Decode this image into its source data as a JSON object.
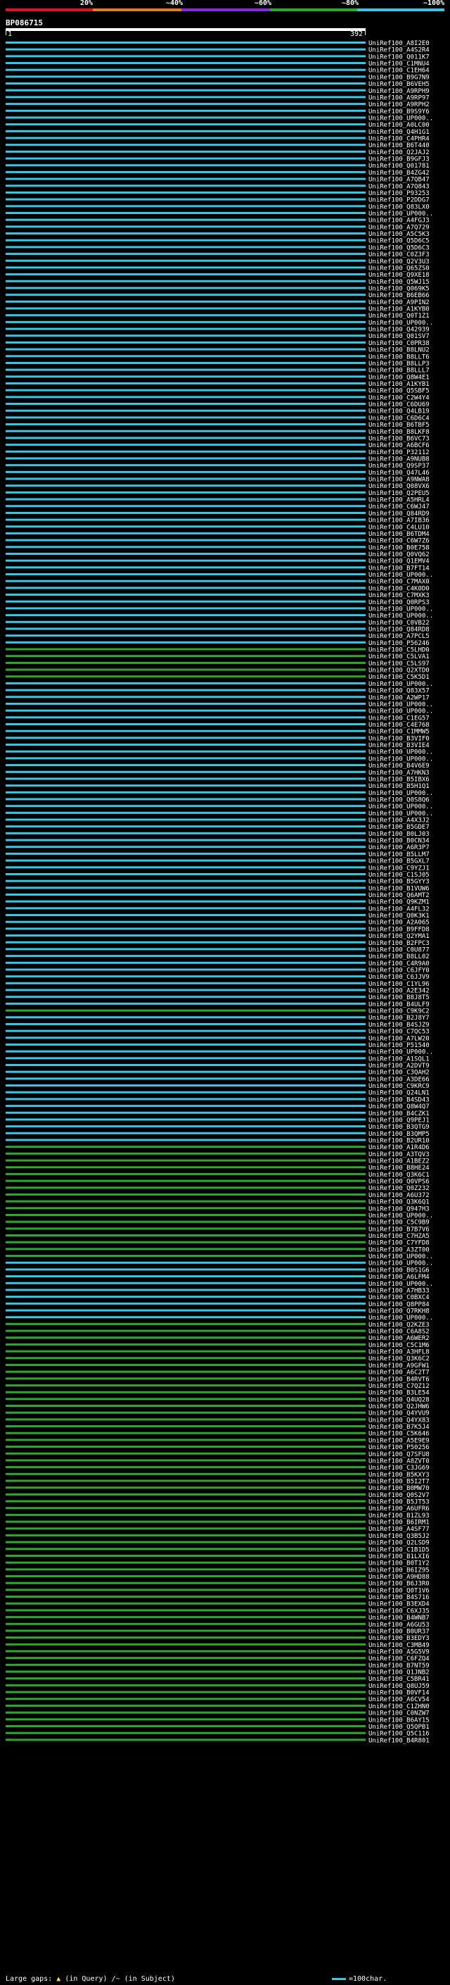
{
  "scale": {
    "labels": [
      "20%",
      "~40%",
      "~60%",
      "~80%",
      "~100%"
    ],
    "colors": [
      "#e0102b",
      "#e07d1a",
      "#8a2be2",
      "#2ea82e",
      "#38c8e6"
    ]
  },
  "query": {
    "id": "BP086715",
    "start": "1",
    "end": "392"
  },
  "hits": [
    {
      "label": "UniRef100_A8I2E0",
      "color": "#38c8e6"
    },
    {
      "label": "UniRef100_A4S2R4",
      "color": "#38c8e6"
    },
    {
      "label": "UniRef100_Q011K7",
      "color": "#38c8e6"
    },
    {
      "label": "UniRef100_C1MNU4",
      "color": "#38c8e6"
    },
    {
      "label": "UniRef100_C1EH64",
      "color": "#38c8e6"
    },
    {
      "label": "UniRef100_B9G7N9",
      "color": "#38c8e6"
    },
    {
      "label": "UniRef100_B6VEH5",
      "color": "#38c8e6"
    },
    {
      "label": "UniRef100_A9RPH9",
      "color": "#38c8e6"
    },
    {
      "label": "UniRef100_A9RP97",
      "color": "#38c8e6"
    },
    {
      "label": "UniRef100_A9RPH2",
      "color": "#38c8e6"
    },
    {
      "label": "UniRef100_B9S9Y6",
      "color": "#38c8e6"
    },
    {
      "label": "UniRef100_UP000..",
      "color": "#38c8e6"
    },
    {
      "label": "UniRef100_A0LC00",
      "color": "#38c8e6"
    },
    {
      "label": "UniRef100_Q4H1G1",
      "color": "#38c8e6"
    },
    {
      "label": "UniRef100_C4PHR4",
      "color": "#38c8e6"
    },
    {
      "label": "UniRef100_B6T440",
      "color": "#38c8e6"
    },
    {
      "label": "UniRef100_Q2JAJ2",
      "color": "#38c8e6"
    },
    {
      "label": "UniRef100_B9GFJ3",
      "color": "#38c8e6"
    },
    {
      "label": "UniRef100_Q01781",
      "color": "#38c8e6"
    },
    {
      "label": "UniRef100_B4ZG42",
      "color": "#38c8e6"
    },
    {
      "label": "UniRef100_A7QB47",
      "color": "#38c8e6"
    },
    {
      "label": "UniRef100_A7Q843",
      "color": "#38c8e6"
    },
    {
      "label": "UniRef100_P93253",
      "color": "#38c8e6"
    },
    {
      "label": "UniRef100_P2DDG7",
      "color": "#38c8e6"
    },
    {
      "label": "UniRef100_Q83LX0",
      "color": "#38c8e6"
    },
    {
      "label": "UniRef100_UP000..",
      "color": "#38c8e6"
    },
    {
      "label": "UniRef100_A4FGJ3",
      "color": "#38c8e6"
    },
    {
      "label": "UniRef100_A7Q729",
      "color": "#38c8e6"
    },
    {
      "label": "UniRef100_A5C5K3",
      "color": "#38c8e6"
    },
    {
      "label": "UniRef100_Q5D6C5",
      "color": "#38c8e6"
    },
    {
      "label": "UniRef100_Q5D6C3",
      "color": "#38c8e6"
    },
    {
      "label": "UniRef100_C0Z3F3",
      "color": "#38c8e6"
    },
    {
      "label": "UniRef100_Q2V3U3",
      "color": "#38c8e6"
    },
    {
      "label": "UniRef100_Q65ZS0",
      "color": "#38c8e6"
    },
    {
      "label": "UniRef100_Q9XE18",
      "color": "#38c8e6"
    },
    {
      "label": "UniRef100_Q5WJ15",
      "color": "#38c8e6"
    },
    {
      "label": "UniRef100_Q069K5",
      "color": "#38c8e6"
    },
    {
      "label": "UniRef100_B6EB66",
      "color": "#38c8e6"
    },
    {
      "label": "UniRef100_A9PIN2",
      "color": "#38c8e6"
    },
    {
      "label": "UniRef100_A1KYB0",
      "color": "#38c8e6"
    },
    {
      "label": "UniRef100_Q0T1Z1",
      "color": "#38c8e6"
    },
    {
      "label": "UniRef100_UP000..",
      "color": "#38c8e6"
    },
    {
      "label": "UniRef100_Q42939",
      "color": "#38c8e6"
    },
    {
      "label": "UniRef100_Q01SV7",
      "color": "#38c8e6"
    },
    {
      "label": "UniRef100_C0PR38",
      "color": "#38c8e6"
    },
    {
      "label": "UniRef100_B8LNU2",
      "color": "#38c8e6"
    },
    {
      "label": "UniRef100_B8LLT6",
      "color": "#38c8e6"
    },
    {
      "label": "UniRef100_B8LLP3",
      "color": "#38c8e6"
    },
    {
      "label": "UniRef100_B8LLL7",
      "color": "#38c8e6"
    },
    {
      "label": "UniRef100_Q8W4E1",
      "color": "#38c8e6"
    },
    {
      "label": "UniRef100_A1KYB1",
      "color": "#38c8e6"
    },
    {
      "label": "UniRef100_Q5SBF5",
      "color": "#38c8e6"
    },
    {
      "label": "UniRef100_C2W4Y4",
      "color": "#38c8e6"
    },
    {
      "label": "UniRef100_C6DU69",
      "color": "#38c8e6"
    },
    {
      "label": "UniRef100_Q4LB19",
      "color": "#38c8e6"
    },
    {
      "label": "UniRef100_C6D6C4",
      "color": "#38c8e6"
    },
    {
      "label": "UniRef100_B6TBF5",
      "color": "#38c8e6"
    },
    {
      "label": "UniRef100_B8LKF8",
      "color": "#38c8e6"
    },
    {
      "label": "UniRef100_B6VC73",
      "color": "#38c8e6"
    },
    {
      "label": "UniRef100_A6BCF6",
      "color": "#38c8e6"
    },
    {
      "label": "UniRef100_P32112",
      "color": "#38c8e6"
    },
    {
      "label": "UniRef100_A9NUB8",
      "color": "#38c8e6"
    },
    {
      "label": "UniRef100_Q9SP37",
      "color": "#38c8e6"
    },
    {
      "label": "UniRef100_Q47L46",
      "color": "#38c8e6"
    },
    {
      "label": "UniRef100_A9NWA8",
      "color": "#38c8e6"
    },
    {
      "label": "UniRef100_Q08VX6",
      "color": "#38c8e6"
    },
    {
      "label": "UniRef100_Q2PEU5",
      "color": "#38c8e6"
    },
    {
      "label": "UniRef100_A5HRL4",
      "color": "#38c8e6"
    },
    {
      "label": "UniRef100_C6WJ47",
      "color": "#38c8e6"
    },
    {
      "label": "UniRef100_Q84RD9",
      "color": "#38c8e6"
    },
    {
      "label": "UniRef100_A7IB36",
      "color": "#38c8e6"
    },
    {
      "label": "UniRef100_C4LU10",
      "color": "#38c8e6"
    },
    {
      "label": "UniRef100_B6TDM4",
      "color": "#38c8e6"
    },
    {
      "label": "UniRef100_C6W7Z6",
      "color": "#38c8e6"
    },
    {
      "label": "UniRef100_B0E758",
      "color": "#38c8e6"
    },
    {
      "label": "UniRef100_Q0VQ62",
      "color": "#38c8e6"
    },
    {
      "label": "UniRef100_Q1EMV4",
      "color": "#38c8e6"
    },
    {
      "label": "UniRef100_B7FT14",
      "color": "#38c8e6"
    },
    {
      "label": "UniRef100_UP000..",
      "color": "#38c8e6"
    },
    {
      "label": "UniRef100_C7MAX0",
      "color": "#38c8e6"
    },
    {
      "label": "UniRef100_C4K0D0",
      "color": "#38c8e6"
    },
    {
      "label": "UniRef100_C7MXK3",
      "color": "#38c8e6"
    },
    {
      "label": "UniRef100_Q0RPS3",
      "color": "#38c8e6"
    },
    {
      "label": "UniRef100_UP000..",
      "color": "#38c8e6"
    },
    {
      "label": "UniRef100_UP000..",
      "color": "#38c8e6"
    },
    {
      "label": "UniRef100_C0VB22",
      "color": "#38c8e6"
    },
    {
      "label": "UniRef100_Q84RD8",
      "color": "#38c8e6"
    },
    {
      "label": "UniRef100_A7PCL5",
      "color": "#38c8e6"
    },
    {
      "label": "UniRef100_P56246",
      "color": "#38c8e6"
    },
    {
      "label": "UniRef100_C5LHD0",
      "color": "#2ea82e"
    },
    {
      "label": "UniRef100_C5LVA1",
      "color": "#2ea82e"
    },
    {
      "label": "UniRef100_C5LS97",
      "color": "#2ea82e"
    },
    {
      "label": "UniRef100_Q2XTD0",
      "color": "#2ea82e"
    },
    {
      "label": "UniRef100_C5K5D1",
      "color": "#2ea82e"
    },
    {
      "label": "UniRef100_UP000..",
      "color": "#38c8e6"
    },
    {
      "label": "UniRef100_Q83X57",
      "color": "#38c8e6"
    },
    {
      "label": "UniRef100_A2WP17",
      "color": "#38c8e6"
    },
    {
      "label": "UniRef100_UP000..",
      "color": "#38c8e6"
    },
    {
      "label": "UniRef100_UP000..",
      "color": "#38c8e6"
    },
    {
      "label": "UniRef100_C1EG57",
      "color": "#38c8e6"
    },
    {
      "label": "UniRef100_C4E768",
      "color": "#38c8e6"
    },
    {
      "label": "UniRef100_C1MMW5",
      "color": "#38c8e6"
    },
    {
      "label": "UniRef100_B3VIF0",
      "color": "#38c8e6"
    },
    {
      "label": "UniRef100_B3VIE4",
      "color": "#38c8e6"
    },
    {
      "label": "UniRef100_UP000..",
      "color": "#38c8e6"
    },
    {
      "label": "UniRef100_UP000..",
      "color": "#38c8e6"
    },
    {
      "label": "UniRef100_B4V6E9",
      "color": "#38c8e6"
    },
    {
      "label": "UniRef100_A7HKN3",
      "color": "#38c8e6"
    },
    {
      "label": "UniRef100_B5IBX6",
      "color": "#38c8e6"
    },
    {
      "label": "UniRef100_B5H1Q1",
      "color": "#38c8e6"
    },
    {
      "label": "UniRef100_UP000..",
      "color": "#38c8e6"
    },
    {
      "label": "UniRef100_Q0S8Q6",
      "color": "#38c8e6"
    },
    {
      "label": "UniRef100_UP000..",
      "color": "#38c8e6"
    },
    {
      "label": "UniRef100_UP000..",
      "color": "#38c8e6"
    },
    {
      "label": "UniRef100_A4X3J2",
      "color": "#38c8e6"
    },
    {
      "label": "UniRef100_B5GDE7",
      "color": "#38c8e6"
    },
    {
      "label": "UniRef100_B0LJ03",
      "color": "#38c8e6"
    },
    {
      "label": "UniRef100_B0CN34",
      "color": "#38c8e6"
    },
    {
      "label": "UniRef100_A6R3P7",
      "color": "#38c8e6"
    },
    {
      "label": "UniRef100_B5LLM7",
      "color": "#38c8e6"
    },
    {
      "label": "UniRef100_B5GXL7",
      "color": "#38c8e6"
    },
    {
      "label": "UniRef100_C9YZJ1",
      "color": "#38c8e6"
    },
    {
      "label": "UniRef100_C1SJ05",
      "color": "#38c8e6"
    },
    {
      "label": "UniRef100_B5GYY3",
      "color": "#38c8e6"
    },
    {
      "label": "UniRef100_B1VUW6",
      "color": "#38c8e6"
    },
    {
      "label": "UniRef100_Q6AMT2",
      "color": "#38c8e6"
    },
    {
      "label": "UniRef100_Q9KZM1",
      "color": "#38c8e6"
    },
    {
      "label": "UniRef100_A4FL32",
      "color": "#38c8e6"
    },
    {
      "label": "UniRef100_Q0K3K1",
      "color": "#38c8e6"
    },
    {
      "label": "UniRef100_A2A065",
      "color": "#38c8e6"
    },
    {
      "label": "UniRef100_B9FFD8",
      "color": "#38c8e6"
    },
    {
      "label": "UniRef100_Q2YMA1",
      "color": "#38c8e6"
    },
    {
      "label": "UniRef100_B2FPC3",
      "color": "#38c8e6"
    },
    {
      "label": "UniRef100_C0U877",
      "color": "#38c8e6"
    },
    {
      "label": "UniRef100_B8LL02",
      "color": "#38c8e6"
    },
    {
      "label": "UniRef100_C4R9A0",
      "color": "#38c8e6"
    },
    {
      "label": "UniRef100_C6JFY0",
      "color": "#38c8e6"
    },
    {
      "label": "UniRef100_C6JJV9",
      "color": "#38c8e6"
    },
    {
      "label": "UniRef100_C1YL96",
      "color": "#38c8e6"
    },
    {
      "label": "UniRef100_A2E342",
      "color": "#38c8e6"
    },
    {
      "label": "UniRef100_B8J8T5",
      "color": "#38c8e6"
    },
    {
      "label": "UniRef100_B4ULF9",
      "color": "#38c8e6"
    },
    {
      "label": "UniRef100_C9K9C2",
      "color": "#2ea82e"
    },
    {
      "label": "UniRef100_B2J8Y7",
      "color": "#38c8e6"
    },
    {
      "label": "UniRef100_B4SJZ9",
      "color": "#38c8e6"
    },
    {
      "label": "UniRef100_C7QC53",
      "color": "#38c8e6"
    },
    {
      "label": "UniRef100_A7LW20",
      "color": "#38c8e6"
    },
    {
      "label": "UniRef100_P51540",
      "color": "#38c8e6"
    },
    {
      "label": "UniRef100_UP000..",
      "color": "#38c8e6"
    },
    {
      "label": "UniRef100_A1SQL1",
      "color": "#38c8e6"
    },
    {
      "label": "UniRef100_A2DVT9",
      "color": "#38c8e6"
    },
    {
      "label": "UniRef100_C3QAH2",
      "color": "#38c8e6"
    },
    {
      "label": "UniRef100_A3DE66",
      "color": "#38c8e6"
    },
    {
      "label": "UniRef100_C9KRC9",
      "color": "#38c8e6"
    },
    {
      "label": "UniRef100_Q24LN1",
      "color": "#38c8e6"
    },
    {
      "label": "UniRef100_B4SD43",
      "color": "#38c8e6"
    },
    {
      "label": "UniRef100_Q8W4Q7",
      "color": "#38c8e6"
    },
    {
      "label": "UniRef100_B4CZK1",
      "color": "#38c8e6"
    },
    {
      "label": "UniRef100_Q9PEJ1",
      "color": "#38c8e6"
    },
    {
      "label": "UniRef100_B3QTG9",
      "color": "#38c8e6"
    },
    {
      "label": "UniRef100_B3QMP5",
      "color": "#38c8e6"
    },
    {
      "label": "UniRef100_B2UR10",
      "color": "#38c8e6"
    },
    {
      "label": "UniRef100_A1R4D6",
      "color": "#2ea82e"
    },
    {
      "label": "UniRef100_A3TQV3",
      "color": "#2ea82e"
    },
    {
      "label": "UniRef100_A1BEZ2",
      "color": "#2ea82e"
    },
    {
      "label": "UniRef100_B8HE24",
      "color": "#2ea82e"
    },
    {
      "label": "UniRef100_Q3K6C1",
      "color": "#2ea82e"
    },
    {
      "label": "UniRef100_Q0VPS6",
      "color": "#2ea82e"
    },
    {
      "label": "UniRef100_Q0Z232",
      "color": "#2ea82e"
    },
    {
      "label": "UniRef100_A6U372",
      "color": "#2ea82e"
    },
    {
      "label": "UniRef100_Q3K6Q1",
      "color": "#2ea82e"
    },
    {
      "label": "UniRef100_Q947H3",
      "color": "#2ea82e"
    },
    {
      "label": "UniRef100_UP000..",
      "color": "#2ea82e"
    },
    {
      "label": "UniRef100_C5C9B9",
      "color": "#2ea82e"
    },
    {
      "label": "UniRef100_B7B7V6",
      "color": "#2ea82e"
    },
    {
      "label": "UniRef100_C7HZA5",
      "color": "#2ea82e"
    },
    {
      "label": "UniRef100_C7YFD8",
      "color": "#2ea82e"
    },
    {
      "label": "UniRef100_A3ZT00",
      "color": "#2ea82e"
    },
    {
      "label": "UniRef100_UP000..",
      "color": "#2ea82e"
    },
    {
      "label": "UniRef100_UP000..",
      "color": "#38c8e6"
    },
    {
      "label": "UniRef100_B0S1G6",
      "color": "#38c8e6"
    },
    {
      "label": "UniRef100_A6LFM4",
      "color": "#38c8e6"
    },
    {
      "label": "UniRef100_UP000..",
      "color": "#38c8e6"
    },
    {
      "label": "UniRef100_A7HB33",
      "color": "#38c8e6"
    },
    {
      "label": "UniRef100_C0BXC4",
      "color": "#38c8e6"
    },
    {
      "label": "UniRef100_Q8PP84",
      "color": "#38c8e6"
    },
    {
      "label": "UniRef100_Q7RKH8",
      "color": "#38c8e6"
    },
    {
      "label": "UniRef100_UP000..",
      "color": "#38c8e6"
    },
    {
      "label": "UniRef100_Q2KZE3",
      "color": "#2ea82e"
    },
    {
      "label": "UniRef100_C6A8S2",
      "color": "#2ea82e"
    },
    {
      "label": "UniRef100_A6WER2",
      "color": "#2ea82e"
    },
    {
      "label": "UniRef100_C5C1M6",
      "color": "#2ea82e"
    },
    {
      "label": "UniRef100_A3HFL8",
      "color": "#2ea82e"
    },
    {
      "label": "UniRef100_Q3K6C2",
      "color": "#2ea82e"
    },
    {
      "label": "UniRef100_A9GFW1",
      "color": "#2ea82e"
    },
    {
      "label": "UniRef100_A6C2T7",
      "color": "#2ea82e"
    },
    {
      "label": "UniRef100_B4RVT6",
      "color": "#2ea82e"
    },
    {
      "label": "UniRef100_C7QZ12",
      "color": "#2ea82e"
    },
    {
      "label": "UniRef100_B3LE54",
      "color": "#2ea82e"
    },
    {
      "label": "UniRef100_Q4UQ28",
      "color": "#2ea82e"
    },
    {
      "label": "UniRef100_Q2JHW6",
      "color": "#2ea82e"
    },
    {
      "label": "UniRef100_Q4YVU9",
      "color": "#2ea82e"
    },
    {
      "label": "UniRef100_Q4YX83",
      "color": "#2ea82e"
    },
    {
      "label": "UniRef100_B7K5J4",
      "color": "#2ea82e"
    },
    {
      "label": "UniRef100_C5K646",
      "color": "#2ea82e"
    },
    {
      "label": "UniRef100_A5E9E9",
      "color": "#2ea82e"
    },
    {
      "label": "UniRef100_P50256",
      "color": "#2ea82e"
    },
    {
      "label": "UniRef100_Q7SFU8",
      "color": "#2ea82e"
    },
    {
      "label": "UniRef100_A8ZVT0",
      "color": "#2ea82e"
    },
    {
      "label": "UniRef100_C3JG69",
      "color": "#2ea82e"
    },
    {
      "label": "UniRef100_B5KXY3",
      "color": "#2ea82e"
    },
    {
      "label": "UniRef100_B5I2T7",
      "color": "#2ea82e"
    },
    {
      "label": "UniRef100_B0MW70",
      "color": "#2ea82e"
    },
    {
      "label": "UniRef100_Q0S2V7",
      "color": "#2ea82e"
    },
    {
      "label": "UniRef100_B5JT53",
      "color": "#2ea82e"
    },
    {
      "label": "UniRef100_A6UFR6",
      "color": "#2ea82e"
    },
    {
      "label": "UniRef100_B1ZL93",
      "color": "#2ea82e"
    },
    {
      "label": "UniRef100_B6IRM1",
      "color": "#2ea82e"
    },
    {
      "label": "UniRef100_A4SF77",
      "color": "#2ea82e"
    },
    {
      "label": "UniRef100_Q3B5J2",
      "color": "#2ea82e"
    },
    {
      "label": "UniRef100_Q2LSD9",
      "color": "#2ea82e"
    },
    {
      "label": "UniRef100_C1B1D5",
      "color": "#2ea82e"
    },
    {
      "label": "UniRef100_B1LXI6",
      "color": "#2ea82e"
    },
    {
      "label": "UniRef100_B0T1Y2",
      "color": "#2ea82e"
    },
    {
      "label": "UniRef100_B6IZ95",
      "color": "#2ea82e"
    },
    {
      "label": "UniRef100_A9HD88",
      "color": "#2ea82e"
    },
    {
      "label": "UniRef100_B6J3R0",
      "color": "#2ea82e"
    },
    {
      "label": "UniRef100_Q0T1V6",
      "color": "#2ea82e"
    },
    {
      "label": "UniRef100_B4S716",
      "color": "#2ea82e"
    },
    {
      "label": "UniRef100_B3EXD4",
      "color": "#2ea82e"
    },
    {
      "label": "UniRef100_C6XJ35",
      "color": "#2ea82e"
    },
    {
      "label": "UniRef100_B4WNB7",
      "color": "#2ea82e"
    },
    {
      "label": "UniRef100_A6GU53",
      "color": "#2ea82e"
    },
    {
      "label": "UniRef100_B0UR37",
      "color": "#2ea82e"
    },
    {
      "label": "UniRef100_B3EDY3",
      "color": "#2ea82e"
    },
    {
      "label": "UniRef100_C3MB49",
      "color": "#2ea82e"
    },
    {
      "label": "UniRef100_A5G5V9",
      "color": "#2ea82e"
    },
    {
      "label": "UniRef100_C6FZQ4",
      "color": "#2ea82e"
    },
    {
      "label": "UniRef100_B7NT59",
      "color": "#2ea82e"
    },
    {
      "label": "UniRef100_Q1JNB2",
      "color": "#2ea82e"
    },
    {
      "label": "UniRef100_C5BR41",
      "color": "#2ea82e"
    },
    {
      "label": "UniRef100_Q8UJ59",
      "color": "#2ea82e"
    },
    {
      "label": "UniRef100_B0VF14",
      "color": "#2ea82e"
    },
    {
      "label": "UniRef100_A6CV54",
      "color": "#2ea82e"
    },
    {
      "label": "UniRef100_C1ZHN0",
      "color": "#2ea82e"
    },
    {
      "label": "UniRef100_C0NZW7",
      "color": "#2ea82e"
    },
    {
      "label": "UniRef100_B6AY15",
      "color": "#2ea82e"
    },
    {
      "label": "UniRef100_Q5QPB1",
      "color": "#2ea82e"
    },
    {
      "label": "UniRef100_Q5C116",
      "color": "#2ea82e"
    },
    {
      "label": "UniRef100_B4R801",
      "color": "#2ea82e"
    }
  ],
  "legend": {
    "large_gaps": "Large gaps:",
    "in_query": "(in Query)",
    "in_subject": "/~ (in Subject)",
    "scale_label": "=100char."
  }
}
